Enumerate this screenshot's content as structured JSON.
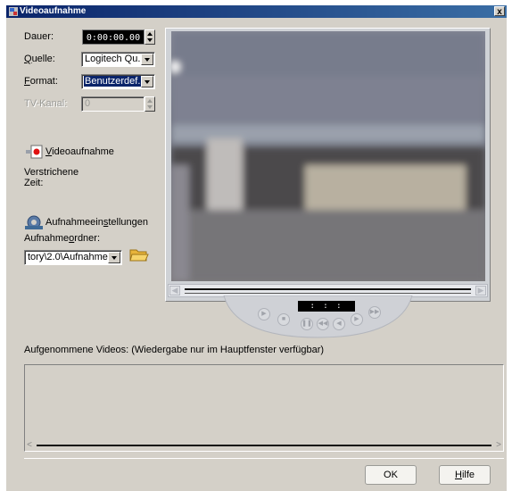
{
  "window": {
    "title": "Videoaufnahme",
    "close_glyph": "x"
  },
  "labels": {
    "dauer": "Dauer:",
    "quelle_u": "Q",
    "quelle_rest": "uelle:",
    "format_u": "F",
    "format_rest": "ormat:",
    "tvkanal": "TV-Kanal:",
    "videoaufnahme_u": "V",
    "videoaufnahme_rest": "ideoaufnahme",
    "verstrichene": "Verstrichene",
    "zeit": "Zeit:",
    "einstellungen_a": "Aufnahmeein",
    "einstellungen_u": "s",
    "einstellungen_b": "tellungen",
    "ordner_a": "Aufnahme",
    "ordner_u": "o",
    "ordner_b": "rdner:",
    "videos_list": "Aufgenommene Videos: (Wiedergabe nur im Hauptfenster verfügbar)"
  },
  "fields": {
    "dauer_value": "0:00:00.00",
    "quelle_value": "Logitech Qu...",
    "format_value": "Benutzerdef...",
    "tvkanal_value": "0",
    "ordner_value": "tory\\2.0\\Aufnahme"
  },
  "player": {
    "clock": ": : :"
  },
  "buttons": {
    "ok": "OK",
    "hilfe_u": "H",
    "hilfe_rest": "ilfe"
  },
  "icons": [
    "record-icon",
    "settings-icon",
    "folder-icon"
  ],
  "colors": {
    "title_gradient_start": "#0a246a",
    "title_gradient_end": "#3a6ea5",
    "dialog_bg": "#d4d0c8",
    "selection": "#0a246a"
  }
}
